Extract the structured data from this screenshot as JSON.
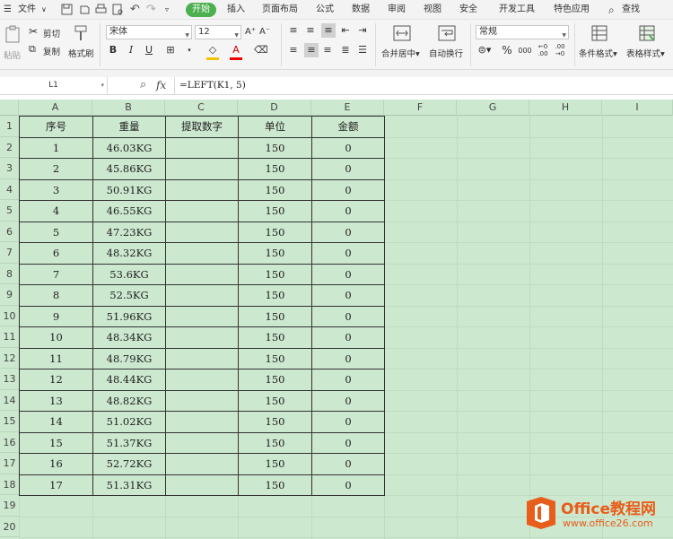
{
  "menu": {
    "file": "文件",
    "start": "开始",
    "insert": "插入",
    "layout": "页面布局",
    "formula": "公式",
    "data": "数据",
    "review": "审阅",
    "view": "视图",
    "security": "安全",
    "dev": "开发工具",
    "special": "特色应用",
    "search": "查找"
  },
  "ribbon": {
    "paste": "粘贴",
    "cut": "剪切",
    "copy": "复制",
    "format_painter": "格式刷",
    "font": "宋体",
    "size": "12",
    "bold": "B",
    "italic": "I",
    "underline": "U",
    "font_grow": "A⁺",
    "font_shrink": "A⁻",
    "merge": "合并居中",
    "wrap": "自动换行",
    "number_format": "常规",
    "percent": "%",
    "thousands": "000",
    "cond_format": "条件格式",
    "table_style": "表格样式"
  },
  "formula_bar": {
    "cell": "L1",
    "fx": "fx",
    "formula": "=LEFT(K1, 5)"
  },
  "columns": [
    "A",
    "B",
    "C",
    "D",
    "E",
    "F",
    "G",
    "H",
    "I"
  ],
  "rows": [
    "1",
    "2",
    "3",
    "4",
    "5",
    "6",
    "7",
    "8",
    "9",
    "10",
    "11",
    "12",
    "13",
    "14",
    "15",
    "16",
    "17",
    "18",
    "19",
    "20"
  ],
  "table": {
    "headers": [
      "序号",
      "重量",
      "提取数字",
      "单位",
      "金额"
    ],
    "rows": [
      [
        "1",
        "46.03KG",
        "",
        "150",
        "0"
      ],
      [
        "2",
        "45.86KG",
        "",
        "150",
        "0"
      ],
      [
        "3",
        "50.91KG",
        "",
        "150",
        "0"
      ],
      [
        "4",
        "46.55KG",
        "",
        "150",
        "0"
      ],
      [
        "5",
        "47.23KG",
        "",
        "150",
        "0"
      ],
      [
        "6",
        "48.32KG",
        "",
        "150",
        "0"
      ],
      [
        "7",
        "53.6KG",
        "",
        "150",
        "0"
      ],
      [
        "8",
        "52.5KG",
        "",
        "150",
        "0"
      ],
      [
        "9",
        "51.96KG",
        "",
        "150",
        "0"
      ],
      [
        "10",
        "48.34KG",
        "",
        "150",
        "0"
      ],
      [
        "11",
        "48.79KG",
        "",
        "150",
        "0"
      ],
      [
        "12",
        "48.44KG",
        "",
        "150",
        "0"
      ],
      [
        "13",
        "48.82KG",
        "",
        "150",
        "0"
      ],
      [
        "14",
        "51.02KG",
        "",
        "150",
        "0"
      ],
      [
        "15",
        "51.37KG",
        "",
        "150",
        "0"
      ],
      [
        "16",
        "52.72KG",
        "",
        "150",
        "0"
      ],
      [
        "17",
        "51.31KG",
        "",
        "150",
        "0"
      ]
    ]
  },
  "watermark": {
    "brand": "Office教程网",
    "url": "www.office26.com"
  },
  "colors": {
    "accent": "#4caf50",
    "sheet": "#cce8cf",
    "logo": "#e85d1a"
  }
}
